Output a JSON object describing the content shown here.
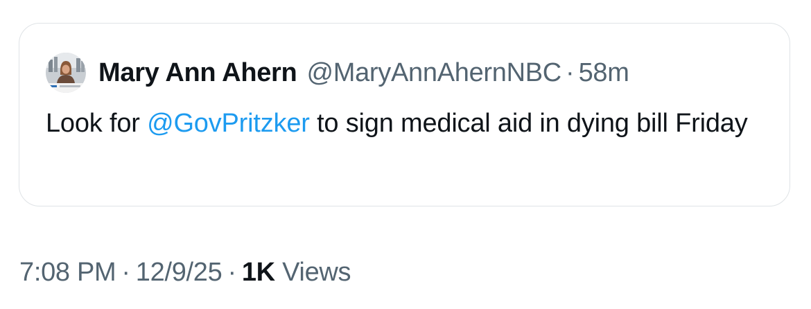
{
  "quoted_tweet": {
    "display_name": "Mary Ann Ahern",
    "handle": "@MaryAnnAhernNBC",
    "separator": "·",
    "time_ago": "58m",
    "avatar_icon": "profile-photo-avatar",
    "text_before": "Look for ",
    "mention": "@GovPritzker",
    "text_after": " to sign medical aid in dying bill Friday"
  },
  "meta": {
    "time": "7:08 PM",
    "separator": "·",
    "date": "12/9/25",
    "views_count": "1K",
    "views_label": "Views"
  },
  "colors": {
    "text_primary": "#0f1419",
    "text_secondary": "#536471",
    "link": "#1d9bf0",
    "border": "#dfe3e6"
  }
}
